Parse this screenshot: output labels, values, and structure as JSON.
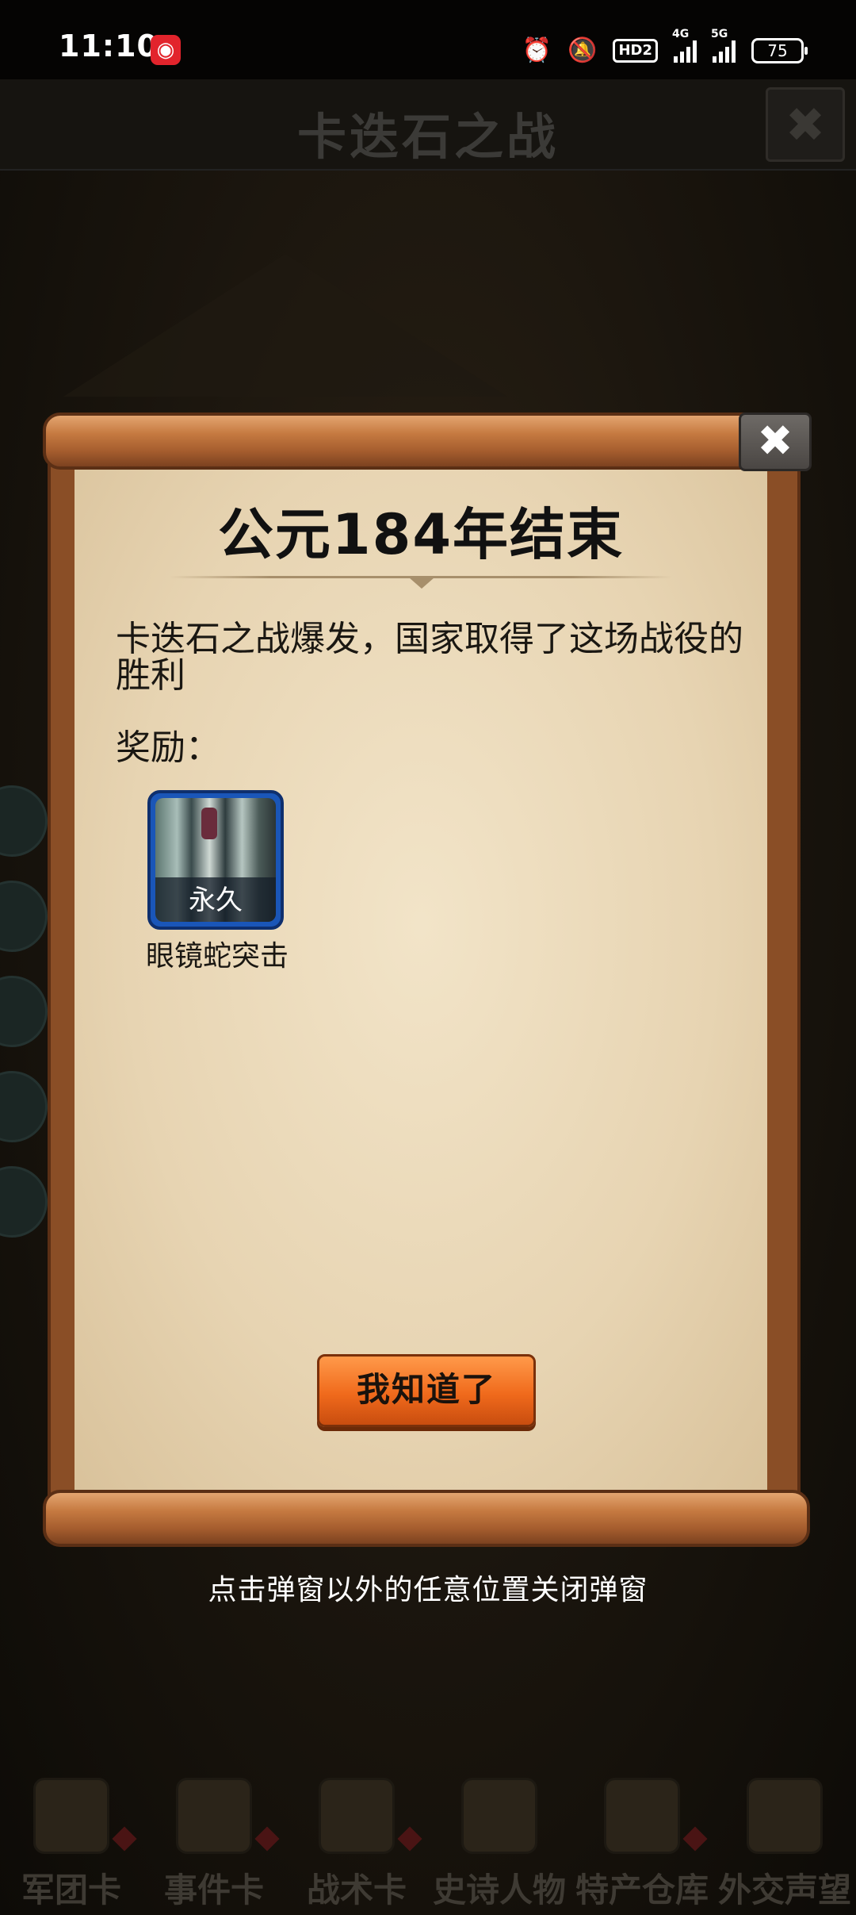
{
  "status_bar": {
    "time": "11:10",
    "app_icon": "netease-music-icon",
    "hd_label": "HD2",
    "net1": "4G",
    "net2": "5G",
    "battery": "75"
  },
  "game": {
    "header_title": "卡迭石之战",
    "nav": [
      {
        "label": "军团卡",
        "icon": "helmet-icon"
      },
      {
        "label": "事件卡",
        "icon": "scroll-icon"
      },
      {
        "label": "战术卡",
        "icon": "compass-icon"
      },
      {
        "label": "史诗人物",
        "icon": "crown-icon"
      },
      {
        "label": "特产仓库",
        "icon": "chest-icon"
      },
      {
        "label": "外交声望",
        "icon": "letter-icon"
      }
    ]
  },
  "dialog": {
    "title": "公元184年结束",
    "message": "卡迭石之战爆发，国家取得了这场战役的胜利",
    "reward_label": "奖励：",
    "reward": {
      "tag": "永久",
      "name": "眼镜蛇突击"
    },
    "confirm": "我知道了",
    "close_glyph": "✖"
  },
  "hint": "点击弹窗以外的任意位置关闭弹窗",
  "colors": {
    "accent_button": "#f06a1c",
    "scroll_wood": "#c67a41",
    "parchment": "#e7d4b2"
  }
}
